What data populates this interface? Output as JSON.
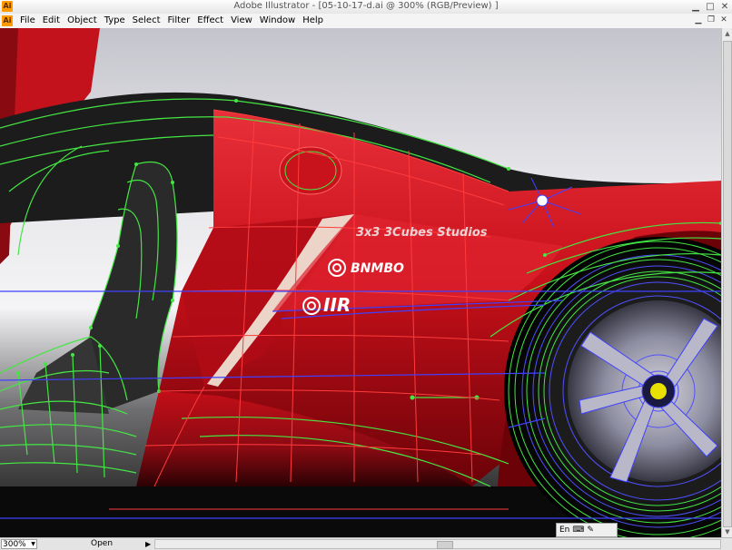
{
  "window": {
    "title": "Adobe Illustrator - [05-10-17-d.ai @ 300% (RGB/Preview) ]",
    "app_icon": "Ai"
  },
  "menu": [
    "File",
    "Edit",
    "Object",
    "Type",
    "Select",
    "Filter",
    "Effect",
    "View",
    "Window",
    "Help"
  ],
  "artwork": {
    "text_studio": "3x3 3Cubes Studios",
    "text_logo1": "BNMBO",
    "text_logo2": "IIR"
  },
  "status": {
    "zoom": "300%",
    "text": "Open"
  },
  "language_bar": {
    "label": "En"
  },
  "colors": {
    "body_red": "#d0101c",
    "wire_green": "#44e644",
    "wire_blue": "#4040ff",
    "wire_red": "#ff3c3c"
  }
}
